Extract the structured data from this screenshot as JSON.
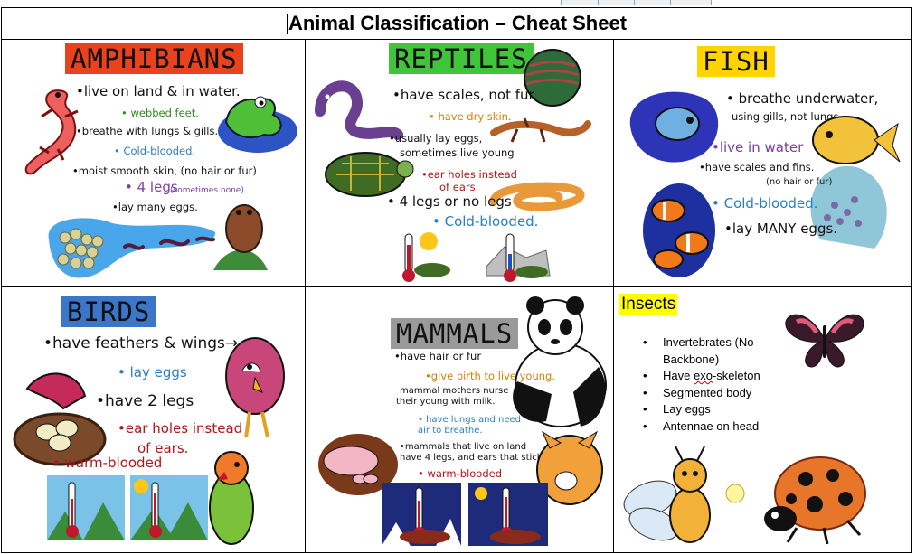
{
  "title": "Animal Classification – Cheat Sheet",
  "colors": {
    "heading_red": "#e8431c",
    "heading_green": "#3fc43a",
    "heading_yellow": "#ffd400",
    "heading_blue": "#3b76c8",
    "heading_gray": "#9a9a9a",
    "highlight": "#ffff00"
  },
  "amphibians": {
    "heading": "AMPHIBIANS",
    "notes": [
      "•live on land & in water.",
      "• webbed feet.",
      "•breathe with lungs & gills.",
      "• Cold-blooded.",
      "•moist smooth skin, (no hair or fur)",
      "• 4 legs",
      "(sometimes none)",
      "•lay many eggs."
    ],
    "icons": [
      "salamander-icon",
      "frog-icon",
      "egg-mass-icon",
      "tadpole-icon",
      "toad-icon"
    ]
  },
  "reptiles": {
    "heading": "REPTILES",
    "notes": [
      "•have scales, not fur.",
      "• have dry skin.",
      "•usually lay eggs,",
      "sometimes live young",
      "•ear holes instead",
      "of ears.",
      "• 4 legs or no legs",
      "• Cold-blooded."
    ],
    "icons": [
      "snake-icon",
      "scales-closeup-icon",
      "lizard-icon",
      "turtle-icon",
      "snake-coil-icon",
      "thermometer-icon"
    ]
  },
  "fish": {
    "heading": "FISH",
    "notes": [
      "• breathe underwater,",
      "using gills, not lungs.",
      "•live in water",
      "•have scales and fins.",
      "(no hair or fur)",
      "• Cold-blooded.",
      "•lay MANY eggs."
    ],
    "icons": [
      "betta-fish-icon",
      "goldfish-icon",
      "clownfish-icon",
      "fish-eggs-icon"
    ]
  },
  "birds": {
    "heading": "BIRDS",
    "notes": [
      "•have feathers & wings→",
      "• lay eggs",
      "•have 2 legs",
      "•ear holes instead",
      "of ears.",
      "• warm-blooded"
    ],
    "icons": [
      "nest-icon",
      "bird-icon",
      "parrot-icon",
      "thermometer-icon"
    ]
  },
  "mammals": {
    "heading": "MAMMALS",
    "notes": [
      "•have hair or fur",
      "•give birth to live young.",
      "mammal mothers nurse",
      "their young with milk.",
      "• have lungs and need",
      "air to breathe.",
      "•mammals that live on land",
      "have 4 legs, and ears that stick out.",
      "• warm-blooded"
    ],
    "icons": [
      "panda-icon",
      "pig-icon",
      "fox-icon",
      "thermometer-icon"
    ]
  },
  "insects": {
    "heading": "Insects",
    "items": [
      "Invertebrates (No Backbone)",
      "Have ",
      "exo",
      "-skeleton",
      "Segmented body",
      "Lay eggs",
      "Antennae on head"
    ],
    "icons": [
      "butterfly-icon",
      "firefly-icon",
      "ladybug-icon"
    ]
  }
}
